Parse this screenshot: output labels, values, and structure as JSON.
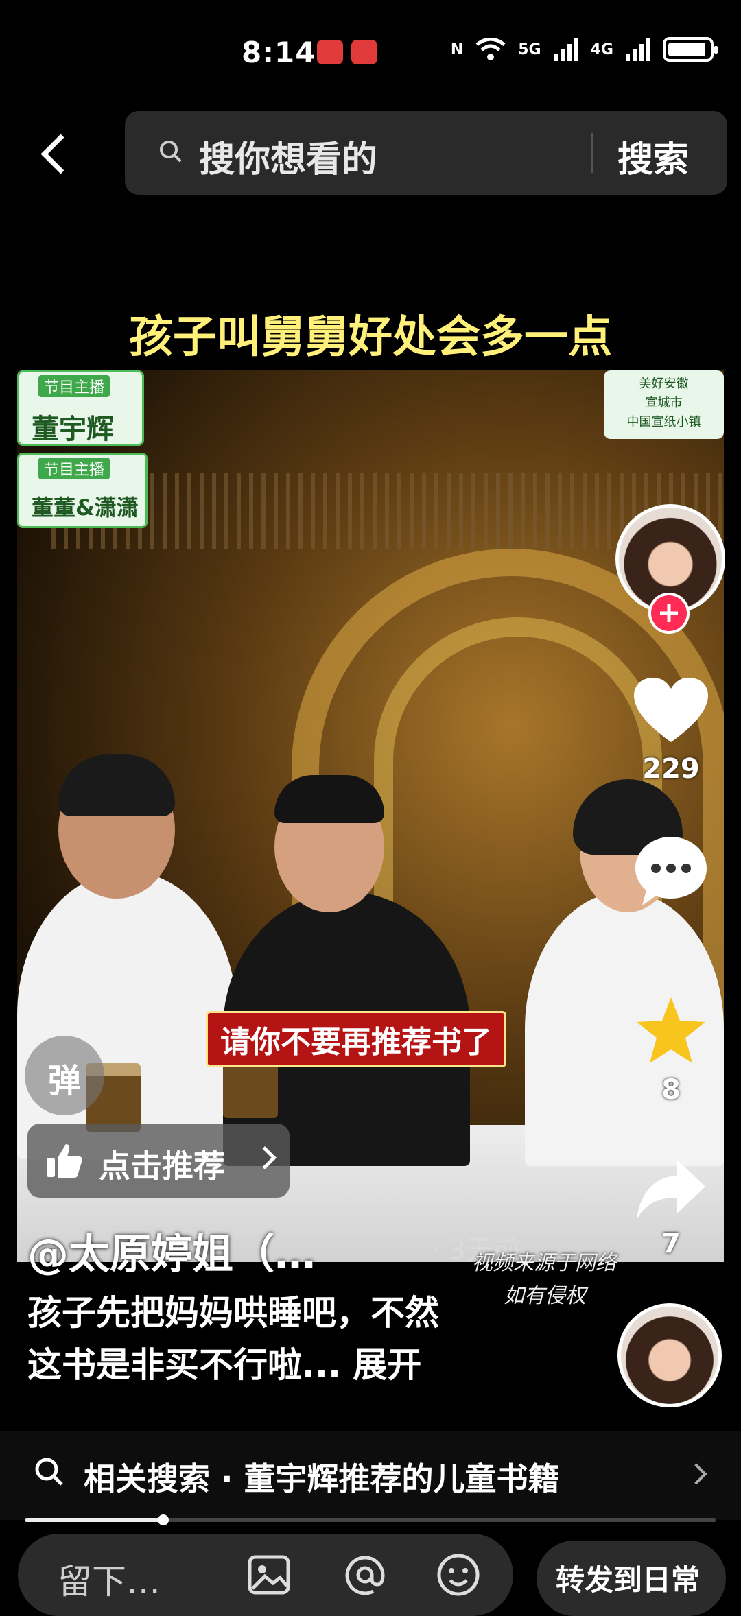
{
  "status_bar": {
    "time": "8:14",
    "network_1": "5G",
    "network_2": "4G"
  },
  "search": {
    "placeholder": "搜你想看的",
    "button": "搜索"
  },
  "video": {
    "top_caption": "孩子叫舅舅好处会多一点",
    "host_tag_1_label": "节目主播",
    "host_tag_1_name": "董宇辉",
    "host_tag_2_label": "节目主播",
    "host_tag_2_name": "董董&潇潇",
    "location_tag": [
      "美好安徽",
      "宣城市",
      "中国宣纸小镇"
    ],
    "subtitle": "请你不要再推荐书了"
  },
  "overlay": {
    "danmu_label": "弹",
    "recommend_label": "点击推荐"
  },
  "rail": {
    "like_count": "229",
    "favorite_count": "8",
    "share_count": "7"
  },
  "post": {
    "author": "@太原婷姐（…",
    "time_ago": "· 3天前",
    "source_note_1": "视频来源于网络",
    "source_note_2": "如有侵权",
    "description_1": "孩子先把妈妈哄睡吧，不然",
    "description_2": "这书是非买不行啦...",
    "expand": "展开"
  },
  "related": {
    "text": "相关搜索 · 董宇辉推荐的儿童书籍"
  },
  "playback": {
    "progress": 0.2
  },
  "comment_bar": {
    "placeholder": "留下…",
    "share_label": "转发到日常"
  },
  "colors": {
    "follow": "#fe2c55",
    "like": "#ffffff",
    "favorite": "#f7c51e"
  }
}
